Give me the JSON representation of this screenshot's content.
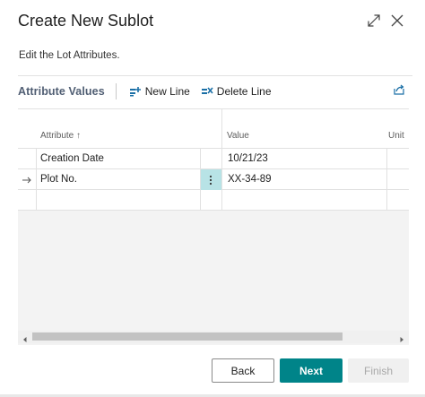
{
  "dialog": {
    "title": "Create New Sublot",
    "subtitle": "Edit the Lot Attributes."
  },
  "part": {
    "title": "Attribute Values",
    "actions": {
      "new_line": "New Line",
      "delete_line": "Delete Line"
    }
  },
  "grid": {
    "columns": {
      "attribute": "Attribute ↑",
      "value": "Value",
      "unit": "Unit"
    },
    "rows": [
      {
        "attribute": "Creation Date",
        "value": "10/21/23",
        "unit": ""
      },
      {
        "attribute": "Plot No.",
        "value": "XX-34-89",
        "unit": ""
      },
      {
        "attribute": "",
        "value": "",
        "unit": ""
      }
    ]
  },
  "footer": {
    "back": "Back",
    "next": "Next",
    "finish": "Finish"
  },
  "colors": {
    "accent": "#008489",
    "selected_cell": "#b8e3e6",
    "part_title": "#505e73"
  },
  "icons": {
    "expand": "expand-icon",
    "close": "close-icon",
    "new_line": "new-line-icon",
    "delete_line": "delete-line-icon",
    "share": "share-icon",
    "row_arrow": "row-arrow-icon",
    "row_menu": "row-menu-dots-icon"
  }
}
